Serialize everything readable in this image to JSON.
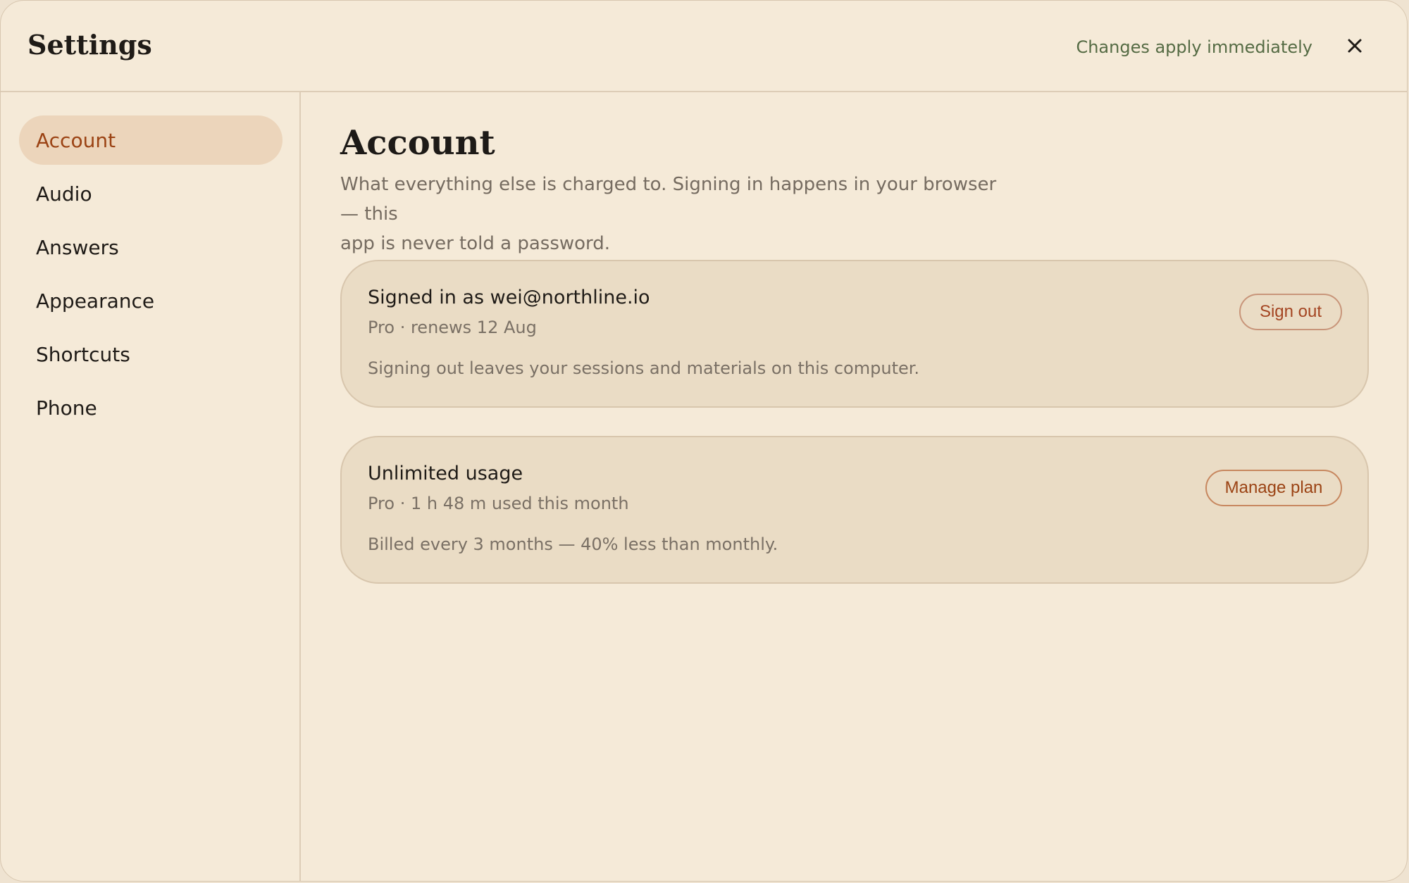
{
  "header": {
    "title": "Settings",
    "status": "Changes apply immediately",
    "close_icon": "close-icon"
  },
  "sidebar": {
    "items": [
      {
        "label": "Account",
        "active": true
      },
      {
        "label": "Audio",
        "active": false
      },
      {
        "label": "Answers",
        "active": false
      },
      {
        "label": "Appearance",
        "active": false
      },
      {
        "label": "Shortcuts",
        "active": false
      },
      {
        "label": "Phone",
        "active": false
      }
    ]
  },
  "main": {
    "title": "Account",
    "description_line1": "What everything else is charged to. Signing in happens in your browser — this",
    "description_line2": "app is never told a password.",
    "cards": [
      {
        "title": "Signed in as wei@northline.io",
        "subtitle": "Pro · renews 12 Aug",
        "note": "Signing out leaves your sessions and materials on this computer.",
        "button": "Sign out"
      },
      {
        "title": "Unlimited usage",
        "subtitle": "Pro · 1 h 48 m used this month",
        "note": "Billed every 3 months — 40% less than monthly.",
        "button": "Manage plan"
      }
    ]
  },
  "colors": {
    "background": "#f5ead8",
    "card": "#eadcc5",
    "active_nav": "#ecd5bb",
    "accent": "#9b4314",
    "status": "#556b44"
  }
}
